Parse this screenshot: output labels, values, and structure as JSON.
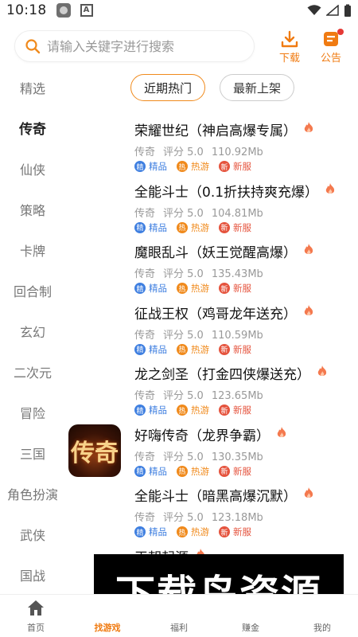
{
  "status_bar": {
    "time": "10:18"
  },
  "search": {
    "placeholder": "请输入关键字进行搜索"
  },
  "top_actions": {
    "download_label": "下载",
    "notice_label": "公告"
  },
  "sidebar": {
    "items": [
      {
        "label": "精选"
      },
      {
        "label": "传奇"
      },
      {
        "label": "仙侠"
      },
      {
        "label": "策略"
      },
      {
        "label": "卡牌"
      },
      {
        "label": "回合制"
      },
      {
        "label": "玄幻"
      },
      {
        "label": "二次元"
      },
      {
        "label": "冒险"
      },
      {
        "label": "三国"
      },
      {
        "label": "角色扮演"
      },
      {
        "label": "武侠"
      },
      {
        "label": "国战"
      }
    ],
    "active_index": 1
  },
  "tabs": [
    {
      "label": "近期热门"
    },
    {
      "label": "最新上架"
    }
  ],
  "tag_labels": {
    "jing_glyph": "精",
    "jing": "精品",
    "re_glyph": "热",
    "re": "热游",
    "xin_glyph": "新",
    "xin": "新服"
  },
  "games": [
    {
      "title": "荣耀世纪（神启高爆专属）",
      "genre": "传奇",
      "rating": "评分 5.0",
      "size": "110.92Mb"
    },
    {
      "title": "全能斗士（0.1折扶持爽充爆）",
      "genre": "传奇",
      "rating": "评分 5.0",
      "size": "104.81Mb"
    },
    {
      "title": "魔眼乱斗（妖王觉醒高爆）",
      "genre": "传奇",
      "rating": "评分 5.0",
      "size": "135.43Mb"
    },
    {
      "title": "征战王权（鸡哥龙年送充）",
      "genre": "传奇",
      "rating": "评分 5.0",
      "size": "110.59Mb"
    },
    {
      "title": "龙之剑圣（打金四侠爆送充）",
      "genre": "传奇",
      "rating": "评分 5.0",
      "size": "123.65Mb"
    },
    {
      "title": "好嗨传奇（龙界争霸）",
      "genre": "传奇",
      "rating": "评分 5.0",
      "size": "130.35Mb",
      "thumb_text": "传奇"
    },
    {
      "title": "全能斗士（暗黑高爆沉默）",
      "genre": "传奇",
      "rating": "评分 5.0",
      "size": "123.18Mb"
    },
    {
      "title": "王朝起源",
      "genre": "",
      "rating": "",
      "size": ""
    }
  ],
  "bottom_nav": {
    "items": [
      {
        "label": "首页"
      },
      {
        "label": "找游戏"
      },
      {
        "label": "福利"
      },
      {
        "label": "赚金"
      },
      {
        "label": "我的"
      }
    ],
    "active_index": 1
  },
  "watermark": {
    "text": "下载鸟资源"
  },
  "colors": {
    "accent": "#f07b12",
    "tag_blue": "#3f7fe0",
    "tag_orange": "#f08a1c",
    "tag_red": "#e5533d"
  }
}
